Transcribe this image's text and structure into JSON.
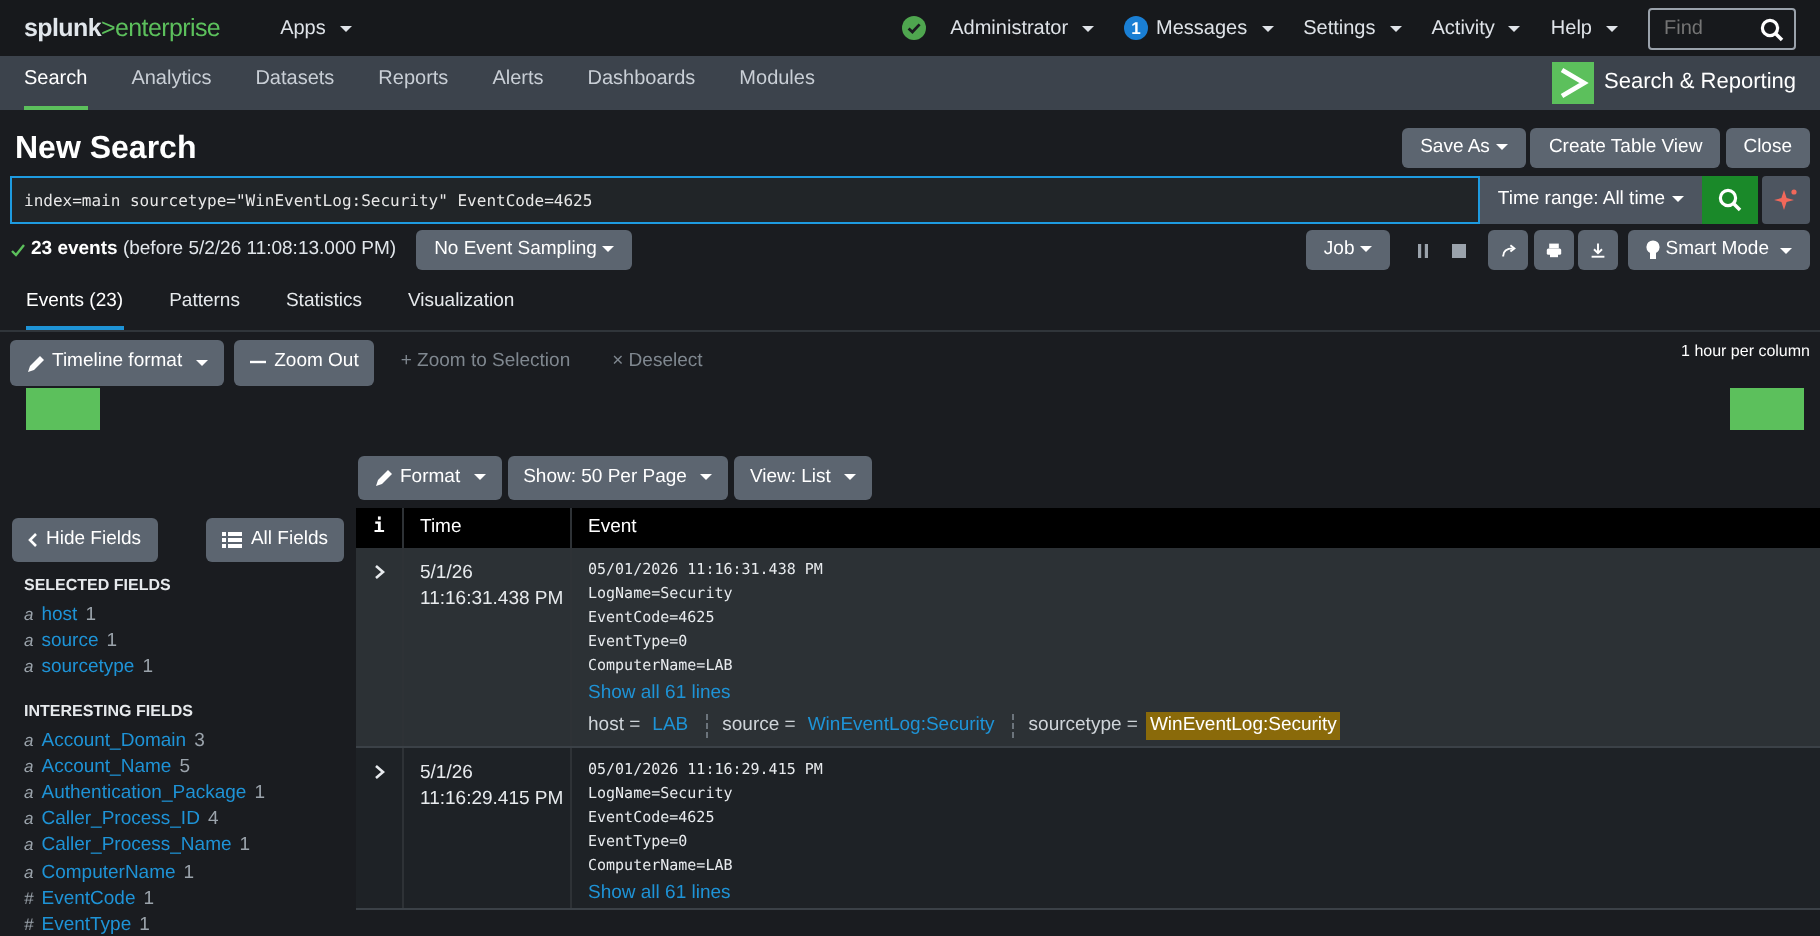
{
  "header": {
    "logo": {
      "brand": "splunk",
      "product": ">enterprise"
    },
    "apps_menu": "Apps",
    "menus": [
      {
        "kind": "status",
        "label": "Administrator"
      },
      {
        "kind": "badge",
        "badge": "1",
        "label": "Messages"
      },
      {
        "kind": "plain",
        "label": "Settings"
      },
      {
        "kind": "plain",
        "label": "Activity"
      },
      {
        "kind": "plain",
        "label": "Help"
      }
    ],
    "find": {
      "placeholder": "Find"
    }
  },
  "app_nav": {
    "tabs": [
      {
        "label": "Search",
        "selected": true
      },
      {
        "label": "Analytics",
        "selected": false
      },
      {
        "label": "Datasets",
        "selected": false
      },
      {
        "label": "Reports",
        "selected": false
      },
      {
        "label": "Alerts",
        "selected": false
      },
      {
        "label": "Dashboards",
        "selected": false
      },
      {
        "label": "Modules",
        "selected": false
      }
    ],
    "app_name": "Search & Reporting"
  },
  "title": "New Search",
  "title_buttons": [
    {
      "label": "Save As",
      "dropdown": true
    },
    {
      "label": "Create Table View",
      "dropdown": false
    },
    {
      "label": "Close",
      "dropdown": false
    }
  ],
  "search": {
    "query": "index=main sourcetype=\"WinEventLog:Security\" EventCode=4625",
    "time_range": "Time range: All time"
  },
  "job_status": {
    "summary": "**23 events** (before 5/2/26 11:08:13.000 PM)",
    "sampling": "No Event Sampling",
    "job": "Job",
    "mode": "Smart Mode"
  },
  "result_tabs": [
    {
      "label": "Events (23)",
      "selected": true
    },
    {
      "label": "Patterns",
      "selected": false
    },
    {
      "label": "Statistics",
      "selected": false
    },
    {
      "label": "Visualization",
      "selected": false
    }
  ],
  "timeline": {
    "tools": [
      {
        "kind": "pencil",
        "label": "Timeline format",
        "disabled": false,
        "dropdown": true
      },
      {
        "kind": "minus",
        "label": "Zoom Out",
        "disabled": false,
        "dropdown": false
      },
      {
        "kind": "text",
        "label": "+ Zoom to Selection",
        "disabled": true,
        "dropdown": false
      },
      {
        "kind": "text",
        "label": "× Deselect",
        "disabled": true,
        "dropdown": false
      }
    ],
    "scale": "1 hour per column"
  },
  "list_tools": [
    {
      "kind": "pencil",
      "label": "Format"
    },
    {
      "kind": "plain",
      "label": "Show: 50 Per Page"
    },
    {
      "kind": "plain",
      "label": "View: List"
    }
  ],
  "sidebar": {
    "hide_button": "Hide Fields",
    "all_button": "All Fields",
    "sections": [
      {
        "title": "SELECTED FIELDS",
        "fields": [
          {
            "type": "a",
            "name": "host",
            "count": "1"
          },
          {
            "type": "a",
            "name": "source",
            "count": "1"
          },
          {
            "type": "a",
            "name": "sourcetype",
            "count": "1"
          }
        ]
      },
      {
        "title": "INTERESTING FIELDS",
        "fields": [
          {
            "type": "a",
            "name": "Account_Domain",
            "count": "3"
          },
          {
            "type": "a",
            "name": "Account_Name",
            "count": "5"
          },
          {
            "type": "a",
            "name": "Authentication_Package",
            "count": "1"
          },
          {
            "type": "a",
            "name": "Caller_Process_ID",
            "count": "4"
          },
          {
            "type": "a",
            "name": "Caller_Process_Name",
            "count": "1"
          },
          {
            "type": "a",
            "name": "ComputerName",
            "count": "1"
          },
          {
            "type": "#",
            "name": "EventCode",
            "count": "1"
          },
          {
            "type": "#",
            "name": "EventType",
            "count": "1"
          }
        ]
      }
    ]
  },
  "table": {
    "columns": [
      "i",
      "Time",
      "Event"
    ],
    "rows": [
      {
        "expanded": false,
        "date": "5/1/26",
        "time": "11:16:31.438 PM",
        "lines": [
          "05/01/2026 11:16:31.438 PM",
          "LogName=Security",
          "EventCode=4625",
          "EventType=0",
          "ComputerName=LAB"
        ],
        "show_all": "Show all 61 lines",
        "fields": [
          {
            "key": "host =",
            "value": "LAB",
            "highlighted": false
          },
          {
            "key": "source =",
            "value": "WinEventLog:Security",
            "highlighted": false
          },
          {
            "key": "sourcetype =",
            "value": "WinEventLog:Security",
            "highlighted": true
          }
        ]
      },
      {
        "expanded": false,
        "date": "5/1/26",
        "time": "11:16:29.415 PM",
        "lines": [
          "05/01/2026 11:16:29.415 PM",
          "LogName=Security",
          "EventCode=4625",
          "EventType=0",
          "ComputerName=LAB"
        ],
        "show_all": "Show all 61 lines"
      }
    ]
  }
}
